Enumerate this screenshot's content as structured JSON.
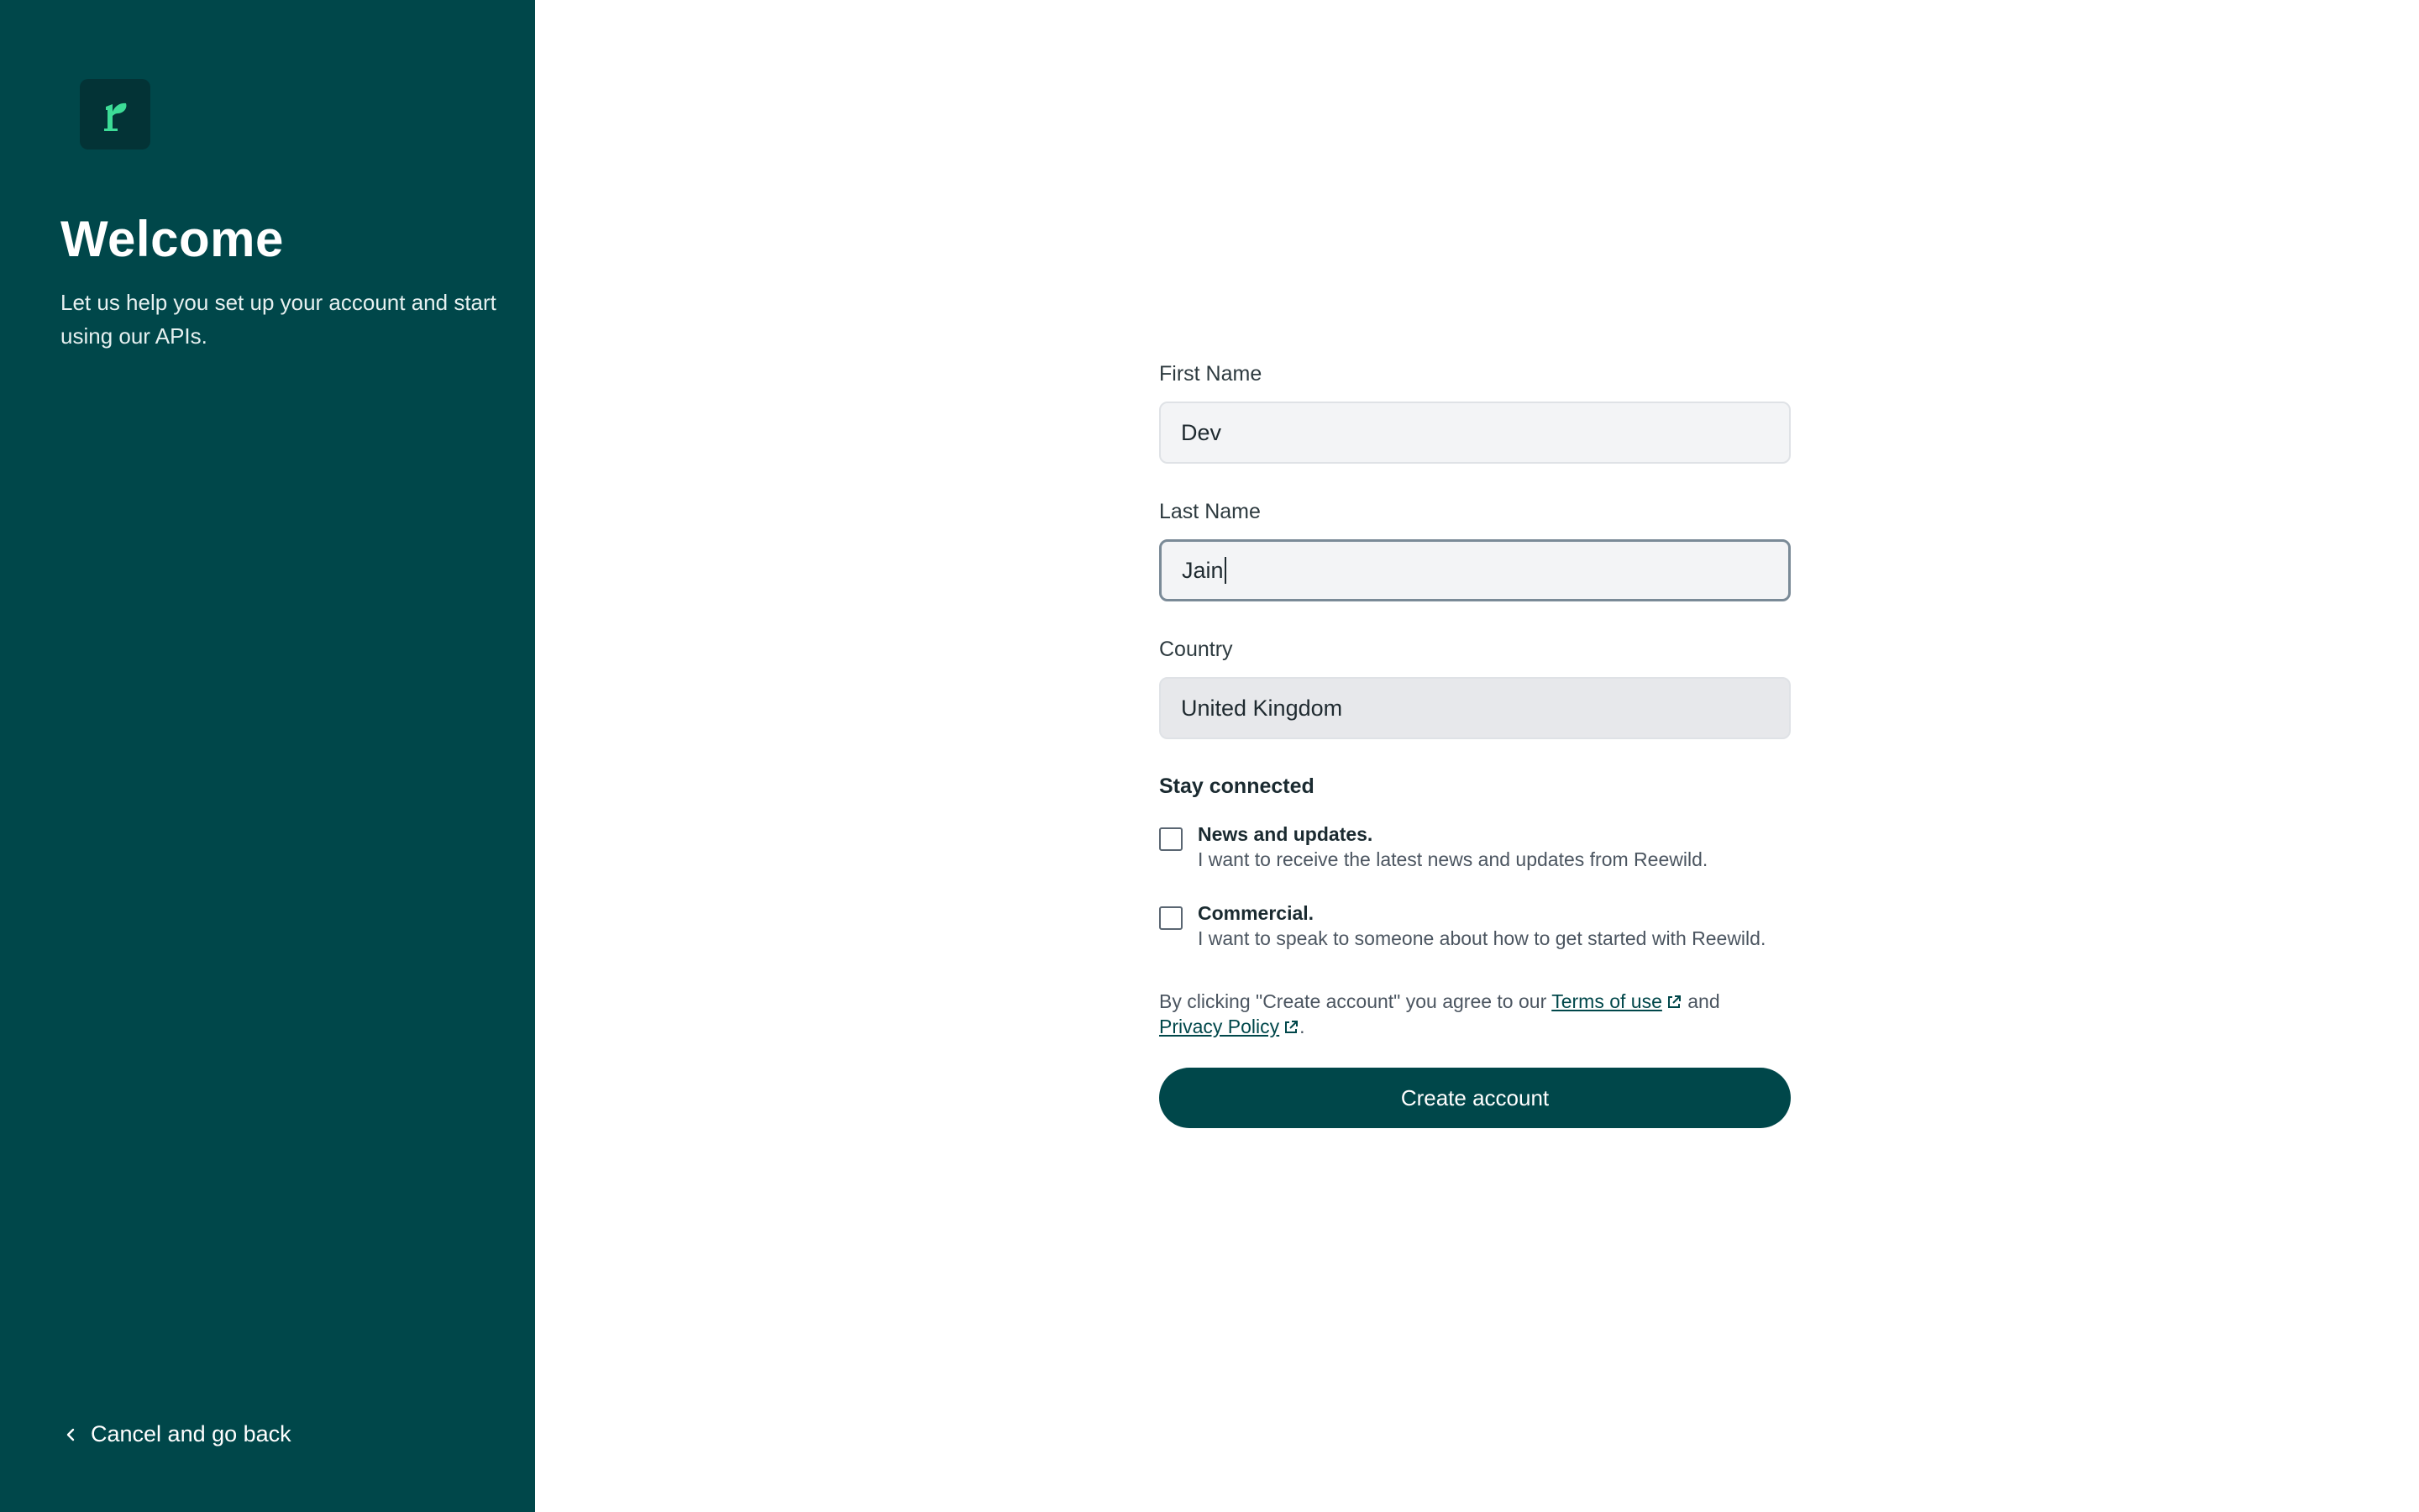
{
  "sidebar": {
    "logo_letter": "r",
    "title": "Welcome",
    "subtitle": "Let us help you set up your account and start using our APIs.",
    "back_label": "Cancel and go back"
  },
  "form": {
    "first_name": {
      "label": "First Name",
      "value": "Dev"
    },
    "last_name": {
      "label": "Last Name",
      "value": "Jain"
    },
    "country": {
      "label": "Country",
      "value": "United Kingdom"
    },
    "stay_connected": "Stay connected",
    "options": [
      {
        "title": "News and updates.",
        "desc": "I want to receive the latest news and updates from Reewild."
      },
      {
        "title": "Commercial.",
        "desc": "I want to speak to someone about how to get started with Reewild."
      }
    ],
    "terms_prefix": "By clicking \"Create account\" you agree to our ",
    "terms_link": "Terms of use",
    "terms_middle": " and ",
    "privacy_link": "Privacy Policy",
    "terms_suffix": ".",
    "submit_label": "Create account"
  },
  "colors": {
    "sidebar_bg": "#00474a",
    "logo_bg": "#033336",
    "logo_accent": "#3ddc97",
    "button_bg": "#00474a"
  }
}
